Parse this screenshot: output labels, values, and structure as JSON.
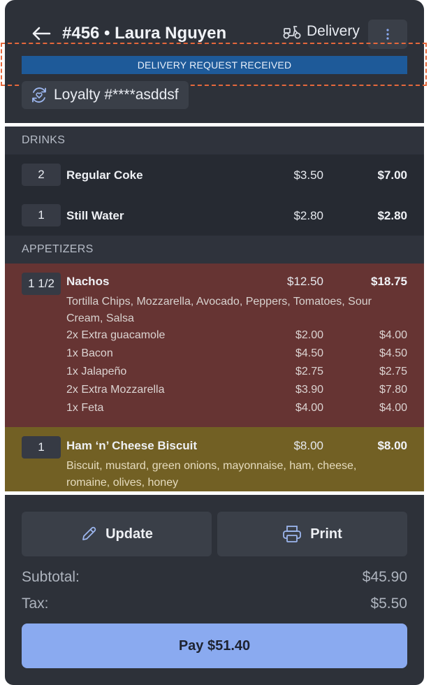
{
  "header": {
    "title": "#456 • Laura Nguyen",
    "order_type": "Delivery",
    "status": "DELIVERY REQUEST RECEIVED",
    "loyalty": "Loyalty #****asddsf"
  },
  "sections": [
    {
      "title": "DRINKS",
      "items": [
        {
          "qty": "2",
          "name": "Regular Coke",
          "price": "$3.50",
          "total": "$7.00"
        },
        {
          "qty": "1",
          "name": "Still Water",
          "price": "$2.80",
          "total": "$2.80"
        }
      ]
    },
    {
      "title": "APPETIZERS",
      "items": [
        {
          "qty": "1 1/2",
          "name": "Nachos",
          "price": "$12.50",
          "total": "$18.75",
          "description": "Tortilla Chips, Mozzarella, Avocado, Peppers, Tomatoes, Sour Cream, Salsa",
          "modifiers": [
            {
              "name": "2x Extra guacamole",
              "price": "$2.00",
              "total": "$4.00"
            },
            {
              "name": "1x Bacon",
              "price": "$4.50",
              "total": "$4.50"
            },
            {
              "name": "1x Jalapeño",
              "price": "$2.75",
              "total": "$2.75"
            },
            {
              "name": "2x Extra Mozzarella",
              "price": "$3.90",
              "total": "$7.80"
            },
            {
              "name": "1x Feta",
              "price": "$4.00",
              "total": "$4.00"
            }
          ]
        },
        {
          "qty": "1",
          "name": "Ham ‘n’ Cheese Biscuit",
          "price": "$8.00",
          "total": "$8.00",
          "description": "Biscuit, mustard, green onions, mayonnaise, ham, cheese, romaine, olives, honey"
        }
      ]
    }
  ],
  "actions": {
    "update": "Update",
    "print": "Print"
  },
  "summary": {
    "subtotal_label": "Subtotal:",
    "subtotal": "$45.90",
    "tax_label": "Tax:",
    "tax": "$5.50"
  },
  "pay_label": "Pay $51.40",
  "colors": {
    "panel": "#2d3139",
    "status_bar": "#1e5a99",
    "highlight_red": "#663433",
    "highlight_olive": "#726024",
    "pay_button": "#8aaaf0"
  },
  "icons": [
    "back-arrow-icon",
    "scooter-icon",
    "more-vertical-icon",
    "loyalty-refresh-icon",
    "pencil-icon",
    "printer-icon"
  ]
}
